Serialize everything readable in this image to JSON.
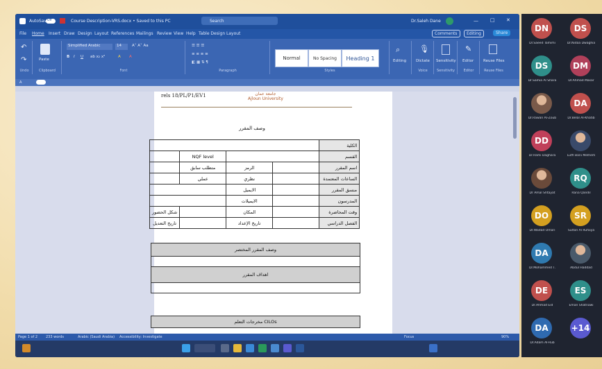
{
  "word": {
    "window_title": "Course Description-VRS.docx • Saved to this PC",
    "autosave_label": "AutoSave",
    "autosave_state": "Off",
    "search_placeholder": "Search",
    "user": "Dr.Saleh Dane",
    "tabs": [
      "File",
      "Home",
      "Insert",
      "Draw",
      "Design",
      "Layout",
      "References",
      "Mailings",
      "Review",
      "View",
      "Help",
      "Table Design",
      "Layout"
    ],
    "comments_label": "Comments",
    "editing_label": "Editing",
    "share_label": "Share",
    "font_name": "Simplified Arabic",
    "font_size": "14",
    "paste_label": "Paste",
    "styles": [
      "Normal",
      "No Spacing",
      "Heading 1"
    ],
    "ribbon_groups": [
      "Undo",
      "Clipboard",
      "Font",
      "Paragraph",
      "Styles",
      "Voice",
      "Sensitivity",
      "Editor",
      "Reuse Files"
    ],
    "ribbon_buttons": [
      "Editing",
      "Dictate",
      "Sensitivity",
      "Editor",
      "Reuse Files"
    ],
    "status": {
      "page": "Page 1 of 2",
      "words": "233 words",
      "language": "Arabic (Saudi Arabia)",
      "accessibility": "Accessibility: Investigate",
      "focus": "Focus",
      "zoom": "90%"
    }
  },
  "document": {
    "header_code": "rels 18/PL/P1/EV1",
    "university_ar": "جامعة عمان",
    "university_en": "Ajloun University",
    "title": "وصف المقرر",
    "rows": {
      "college": "الكلية",
      "department": "القسم",
      "nqf": "NQF level",
      "course_name": "اسم المقرر",
      "code": "الرمز",
      "prereq": "متطلب سابق",
      "credit_hours": "الساعات المعتمدة",
      "theory": "نظري",
      "practical": "عملي",
      "coordinator": "منسق المقرر",
      "email1": "الايميل",
      "instructors": "المدرسون",
      "emails": "الايميلات",
      "lecture_time": "وقت المحاضرة",
      "place": "المكان",
      "attendance_form": "شكل الحضور",
      "semester": "الفصل الدراسي",
      "prep_date": "تاريخ الإعداد",
      "edit_date": "تاريخ التعديل"
    },
    "sec_short_desc": "وصف المقرر المختصر",
    "sec_objectives": "اهداف المقرر",
    "sec_clos": "مخرجات التعلم CILOs"
  },
  "participants": [
    {
      "initials": "DN",
      "name": "Dr.Saeed Tamimi",
      "color": "#c0504d"
    },
    {
      "initials": "DS",
      "name": "Dr.Nidaa Dwaghia",
      "color": "#c0504d"
    },
    {
      "initials": "DS",
      "name": "Dr.Samia Al Shara",
      "color": "#2f8f8a"
    },
    {
      "initials": "DM",
      "name": "Dr.Ahmad Masar",
      "color": "#b0405a"
    },
    {
      "initials": "",
      "name": "Dr.Rawan Al-Zoub",
      "color": "#7a5a4a"
    },
    {
      "initials": "DA",
      "name": "Dr.Belal Al-Khatib",
      "color": "#c0504d"
    },
    {
      "initials": "DD",
      "name": "Dr.Rami Daghara",
      "color": "#c0405a"
    },
    {
      "initials": "",
      "name": "Lutfi Bani Melhem",
      "color": "#3a4a6a"
    },
    {
      "initials": "",
      "name": "Dr Amal Shtayat",
      "color": "#6a4a3a"
    },
    {
      "initials": "RQ",
      "name": "Rana Qandil",
      "color": "#2f8f8a"
    },
    {
      "initials": "DO",
      "name": "Dr.Wadad Omari",
      "color": "#d4a020"
    },
    {
      "initials": "SR",
      "name": "Sultan Al Rufaiya",
      "color": "#d4a020"
    },
    {
      "initials": "DA",
      "name": "Dr.Mohammed T.",
      "color": "#2f7ab0"
    },
    {
      "initials": "",
      "name": "Abdul Haddad",
      "color": "#4a5a6a"
    },
    {
      "initials": "DE",
      "name": "Dr.Ahmad Eid",
      "color": "#c0504d"
    },
    {
      "initials": "ES",
      "name": "Eman Shatnawi",
      "color": "#2f8f8a"
    },
    {
      "initials": "DA",
      "name": "Dr.Adam Al-Rub",
      "color": "#2f6ab0"
    },
    {
      "initials": "+14",
      "name": "",
      "color": "#5a5ad0"
    }
  ]
}
